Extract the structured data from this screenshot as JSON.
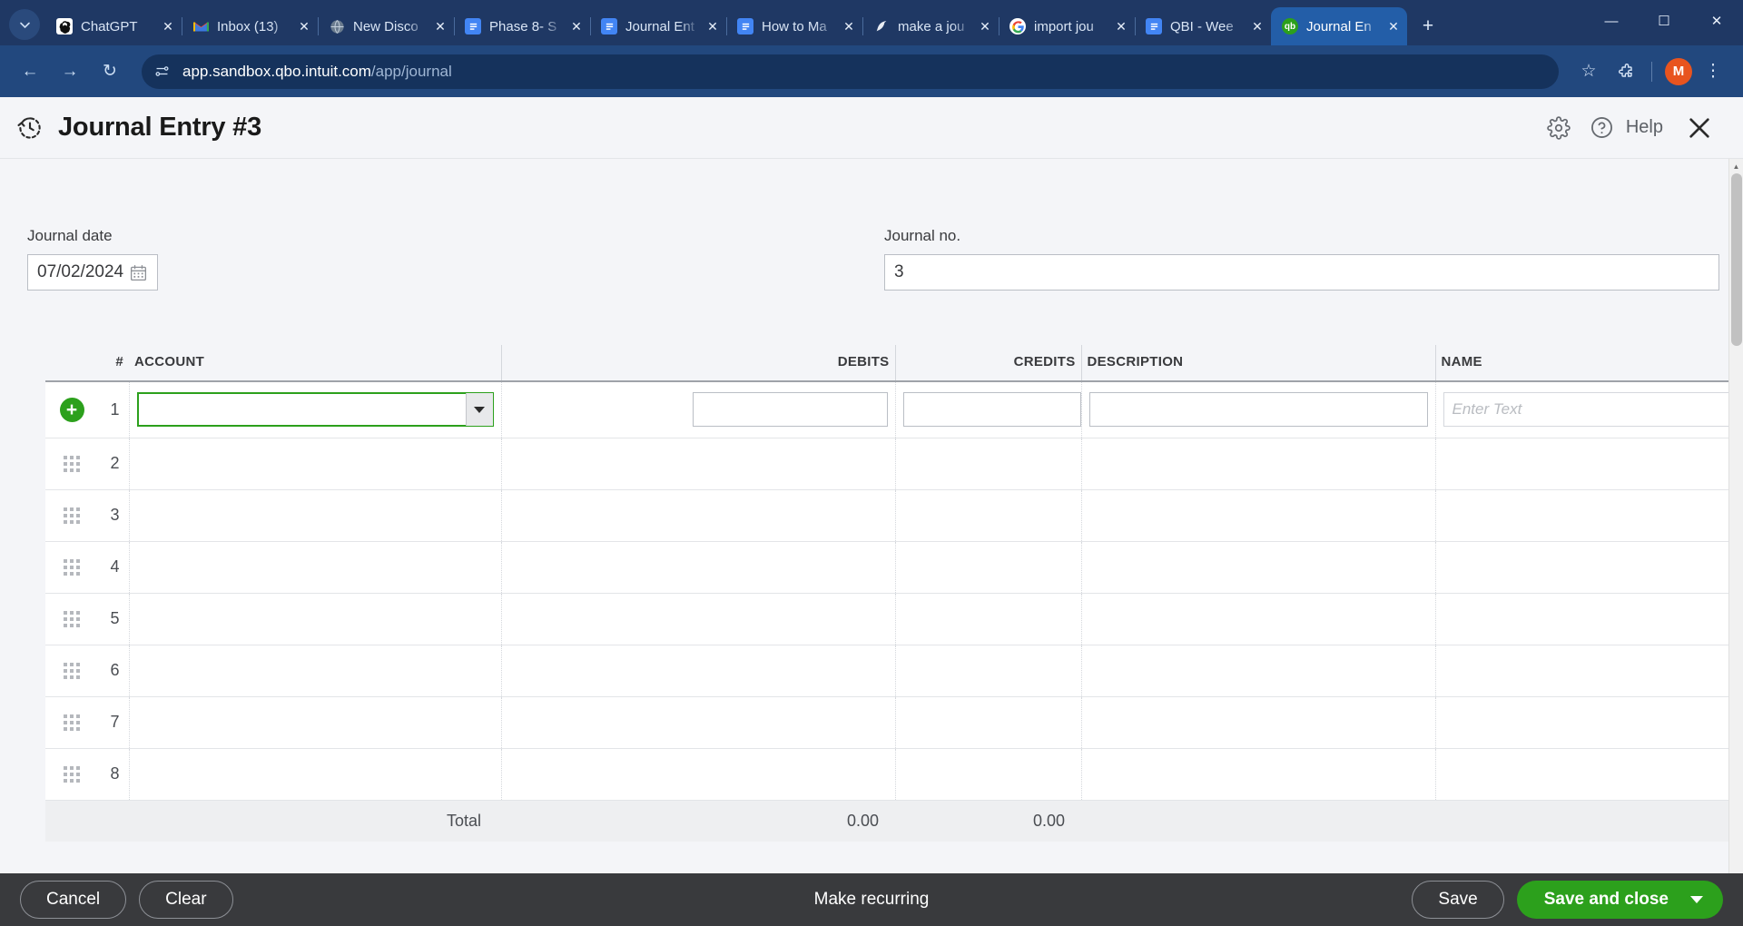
{
  "browser": {
    "tabs": [
      {
        "title": "ChatGPT",
        "favicon": "chatgpt-icon",
        "active": false
      },
      {
        "title": "Inbox (13)",
        "favicon": "gmail-icon",
        "active": false
      },
      {
        "title": "New Disco",
        "favicon": "globe-icon",
        "active": false
      },
      {
        "title": "Phase 8- S",
        "favicon": "docs-icon",
        "active": false
      },
      {
        "title": "Journal Ent",
        "favicon": "docs-icon",
        "active": false
      },
      {
        "title": "How to Ma",
        "favicon": "docs-icon",
        "active": false
      },
      {
        "title": "make a jou",
        "favicon": "quill-icon",
        "active": false
      },
      {
        "title": "import jou",
        "favicon": "google-icon",
        "active": false
      },
      {
        "title": "QBI - Wee",
        "favicon": "docs-icon",
        "active": false
      },
      {
        "title": "Journal En",
        "favicon": "quickbooks-icon",
        "active": true
      }
    ],
    "new_tab_label": "+",
    "tab_list_label": "⌄",
    "close_tab_label": "✕",
    "window_minimize": "—",
    "window_maximize": "☐",
    "window_close": "✕",
    "back_label": "←",
    "forward_label": "→",
    "reload_label": "↻",
    "url_host": "app.sandbox.qbo.intuit.com",
    "url_path": "/app/journal",
    "bookmark_label": "☆",
    "extensions_label": "extensions-icon",
    "avatar_initial": "M",
    "menu_label": "⋮"
  },
  "app": {
    "title": "Journal Entry #3",
    "recurring_icon": "clock-history-icon",
    "settings_icon": "gear-icon",
    "help_icon": "help-circle-icon",
    "help_label": "Help",
    "close_icon": "close-icon"
  },
  "form": {
    "journal_date_label": "Journal date",
    "journal_date_value": "07/02/2024",
    "journal_date_icon": "calendar-icon",
    "journal_no_label": "Journal no.",
    "journal_no_value": "3"
  },
  "table": {
    "headers": {
      "num": "#",
      "account": "ACCOUNT",
      "debits": "DEBITS",
      "credits": "CREDITS",
      "description": "DESCRIPTION",
      "name": "NAME"
    },
    "rows": [
      {
        "n": "1",
        "account": "",
        "debits": "",
        "credits": "",
        "description": "",
        "name": "",
        "name_placeholder": "Enter Text",
        "active": true
      },
      {
        "n": "2",
        "account": "",
        "debits": "",
        "credits": "",
        "description": "",
        "name": "",
        "active": false
      },
      {
        "n": "3",
        "account": "",
        "debits": "",
        "credits": "",
        "description": "",
        "name": "",
        "active": false
      },
      {
        "n": "4",
        "account": "",
        "debits": "",
        "credits": "",
        "description": "",
        "name": "",
        "active": false
      },
      {
        "n": "5",
        "account": "",
        "debits": "",
        "credits": "",
        "description": "",
        "name": "",
        "active": false
      },
      {
        "n": "6",
        "account": "",
        "debits": "",
        "credits": "",
        "description": "",
        "name": "",
        "active": false
      },
      {
        "n": "7",
        "account": "",
        "debits": "",
        "credits": "",
        "description": "",
        "name": "",
        "active": false
      },
      {
        "n": "8",
        "account": "",
        "debits": "",
        "credits": "",
        "description": "",
        "name": "",
        "active": false
      }
    ],
    "total_label": "Total",
    "total_debits": "0.00",
    "total_credits": "0.00",
    "add_row_icon": "plus-circle-icon",
    "drag_icon": "drag-handle-icon",
    "delete_icon": "trash-icon"
  },
  "footer": {
    "cancel_label": "Cancel",
    "clear_label": "Clear",
    "make_recurring_label": "Make recurring",
    "save_label": "Save",
    "save_and_close_label": "Save and close"
  },
  "colors": {
    "brand_green": "#2ca01c",
    "chrome_blue": "#22487e",
    "footer_dark": "#393a3d",
    "avatar_orange": "#e8541f"
  }
}
